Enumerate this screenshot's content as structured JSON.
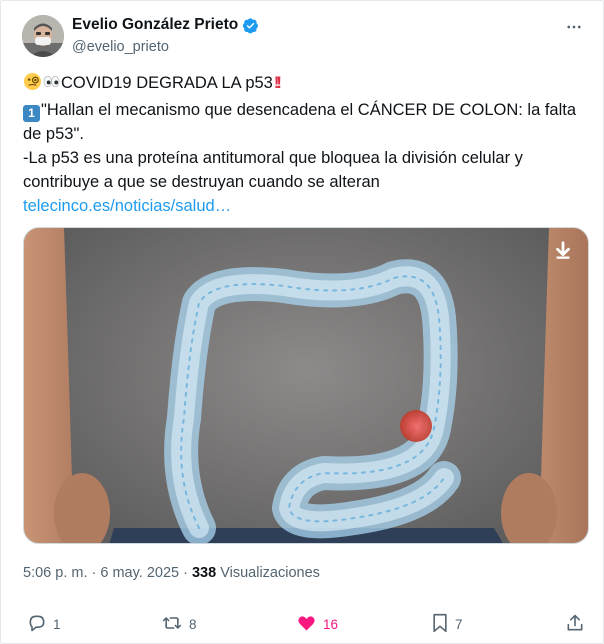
{
  "author": {
    "name": "Evelio González Prieto",
    "handle": "@evelio_prieto",
    "verified": true
  },
  "post": {
    "line1_text": "COVID19 DEGRADA LA p53",
    "line2_keycap": "1",
    "line2_text": "\"Hallan el mecanismo que desencadena el CÁNCER DE COLON: la falta",
    "line3_text": "de p53\".",
    "line4_text": "-La p53 es una proteína antitumoral que bloquea la división celular y",
    "line5_text": "contribuye a que se destruyan cuando se alteran",
    "link_text": "telecinco.es/noticias/salud…"
  },
  "meta": {
    "time_date": "5:06 p. m. · 6 may. 2025 · ",
    "views_count": "338",
    "views_label": " Visualizaciones"
  },
  "actions": {
    "replies": "1",
    "reposts": "8",
    "likes": "16",
    "bookmarks": "7"
  },
  "colors": {
    "accent": "#1d9bf0",
    "like": "#f91880",
    "secondary_text": "#536471"
  },
  "icons": [
    "verified-badge-icon",
    "more-icon",
    "download-icon",
    "reply-icon",
    "repost-icon",
    "heart-icon",
    "bookmark-icon",
    "share-icon"
  ]
}
